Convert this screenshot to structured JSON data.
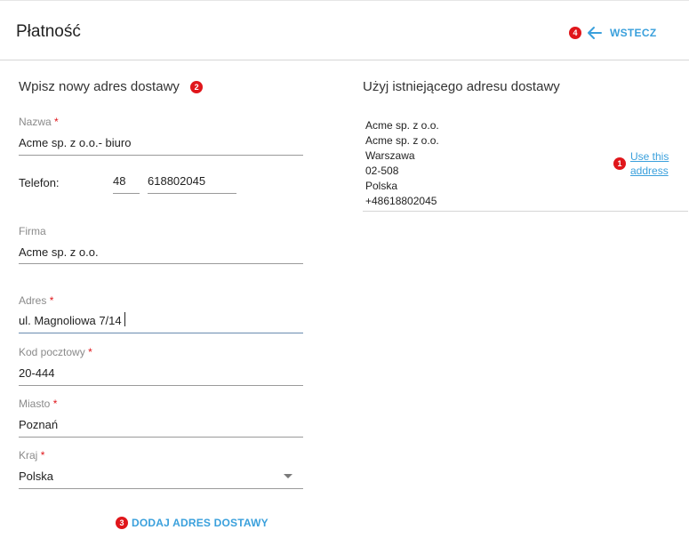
{
  "header": {
    "title": "Płatność",
    "back_label": "WSTECZ",
    "back_badge": "4"
  },
  "new_address": {
    "title": "Wpisz nowy adres dostawy",
    "badge": "2",
    "fields": {
      "name": {
        "label": "Nazwa",
        "required": "*",
        "value": "Acme sp. z o.o.- biuro"
      },
      "phone": {
        "label": "Telefon:",
        "prefix": "48",
        "number": "618802045"
      },
      "company": {
        "label": "Firma",
        "value": "Acme sp. z o.o."
      },
      "address": {
        "label": "Adres",
        "required": "*",
        "value": "ul. Magnoliowa 7/14"
      },
      "postal_code": {
        "label": "Kod pocztowy",
        "required": "*",
        "value": "20-444"
      },
      "city": {
        "label": "Miasto",
        "required": "*",
        "value": "Poznań"
      },
      "country": {
        "label": "Kraj",
        "required": "*",
        "value": "Polska"
      }
    },
    "add_button": {
      "label": "DODAJ ADRES DOSTAWY",
      "badge": "3"
    }
  },
  "existing_address": {
    "title": "Użyj istniejącego adresu dostawy",
    "lines": [
      "Acme sp. z o.o.",
      "Acme sp. z o.o.",
      "Warszawa",
      "02-508",
      "Polska",
      "+48618802045"
    ],
    "use_link": "Use this address",
    "badge": "1"
  },
  "colors": {
    "accent": "#3aa0dc",
    "badge": "#e0161b",
    "required": "#e0161b"
  },
  "icons": {
    "back": "arrow-left-icon",
    "dropdown": "caret-down-icon"
  }
}
